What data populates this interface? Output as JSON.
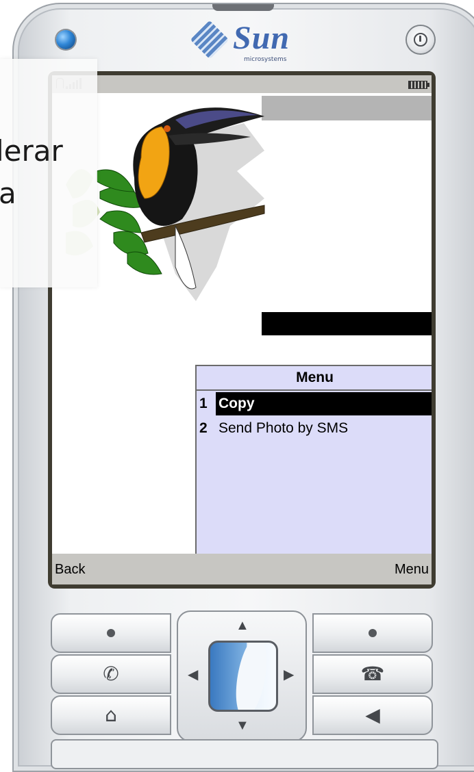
{
  "device": {
    "brand_text": "Sun",
    "brand_sub": "microsystems"
  },
  "overlay": {
    "line1": "lerar",
    "line2": "a"
  },
  "menu": {
    "title": "Menu",
    "items": [
      {
        "number": "1",
        "label": "Copy",
        "selected": true
      },
      {
        "number": "2",
        "label": "Send Photo by SMS",
        "selected": false
      }
    ]
  },
  "softkeys": {
    "left": "Back",
    "right": "Menu"
  },
  "colors": {
    "menu_background": "#dcdcf9",
    "status_bar": "#c7c6c2",
    "selected_item": "#000000"
  }
}
